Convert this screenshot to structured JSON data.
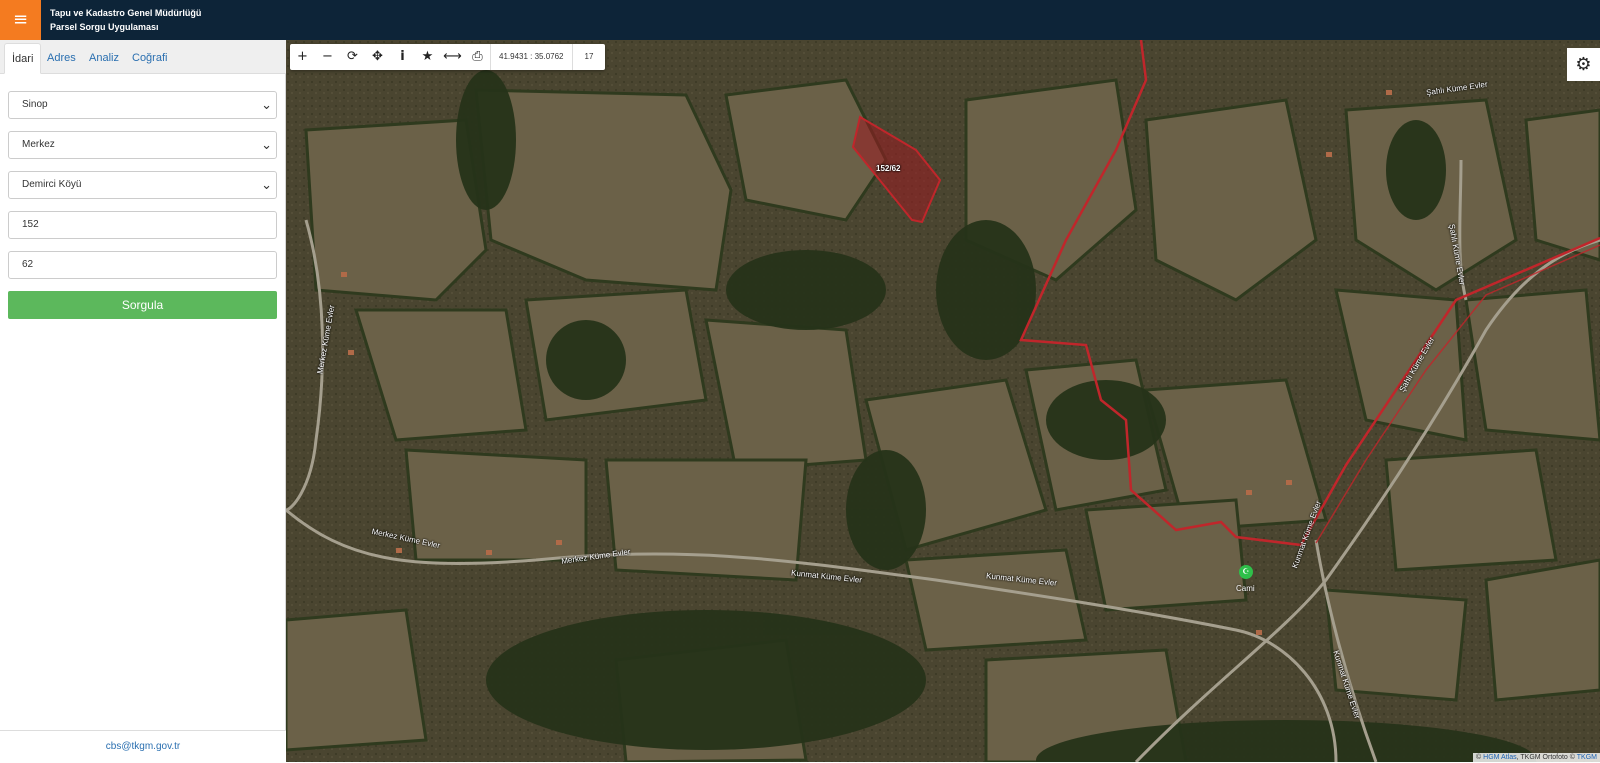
{
  "header": {
    "menu_icon": "hamburger-icon",
    "title_line1": "Tapu ve Kadastro Genel Müdürlüğü",
    "title_line2": "Parsel Sorgu Uygulaması",
    "colors": {
      "background": "#0d2438",
      "menu_button": "#f47b20"
    }
  },
  "sidebar": {
    "tabs": [
      {
        "label": "İdari",
        "active": true
      },
      {
        "label": "Adres",
        "active": false
      },
      {
        "label": "Analiz",
        "active": false
      },
      {
        "label": "Coğrafi",
        "active": false
      }
    ],
    "form": {
      "province": "Sinop",
      "district": "Merkez",
      "neighborhood": "Demirci Köyü",
      "block": "152",
      "parcel": "62",
      "submit_label": "Sorgula"
    },
    "footer_email": "cbs@tkgm.gov.tr"
  },
  "map": {
    "toolbar": {
      "tools": [
        "plus-icon",
        "minus-icon",
        "refresh-icon",
        "locate-icon",
        "info-icon",
        "star-icon",
        "measure-icon",
        "print-icon"
      ],
      "coordinates": "41.9431 : 35.0762",
      "zoom_level": "17"
    },
    "settings_icon": "gear-icon",
    "parcel_label": "152/62",
    "road_labels": {
      "merkez": "Merkez Küme Evler",
      "merkez_lower": "Merkez Küme Evler",
      "kunmat1": "Kunmat Küme Evler",
      "kunmat2": "Kunmat Küme Evler",
      "sahli_top": "Şahlı Küme Evler",
      "sahli_right": "Şahlı Küme Evler",
      "sahli_diag": "Şahlı Küme Evler",
      "merkez_vert": "Merkez Küme Evler",
      "kunmat_diag": "Kunmat Küme Evler",
      "kunmat_bottom": "Kunmat Küme Evler"
    },
    "poi_label": "Cami",
    "attribution": {
      "prefix": "©",
      "source1": "HGM Atlas",
      "middle": ", TKGM Ortofoto ©",
      "source2": "TKGM"
    },
    "colors": {
      "boundary": "#c0262b",
      "parcel_fill": "#9b1c22"
    }
  }
}
